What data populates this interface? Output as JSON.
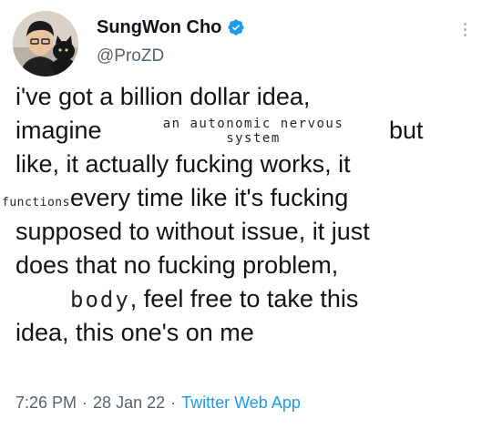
{
  "author": {
    "display_name": "SungWon Cho",
    "handle": "@ProZD",
    "verified": true
  },
  "tweet": {
    "line1": "i've got a billion dollar idea,",
    "line2_start": "imagine",
    "line2_inset_1": "an autonomic nervous",
    "line2_inset_2": "system",
    "line2_end": "but",
    "line3": "like, it actually fucking works, it",
    "line4_inset": "functions",
    "line4_rest": "every time like it's fucking",
    "line5": "supposed to without issue, it just",
    "line6": "does that no fucking problem,",
    "line7_inset": "body",
    "line7_rest": ", feel free to take this",
    "line8": "idea, this one's on me"
  },
  "meta": {
    "time": "7:26 PM",
    "date": "28 Jan 22",
    "separator": "·",
    "source_app": "Twitter Web App"
  },
  "colors": {
    "text": "#0f1419",
    "secondary": "#536471",
    "accent": "#1d9bf0"
  },
  "icons": {
    "verified": "verified-badge-icon",
    "more": "more-options-icon"
  }
}
